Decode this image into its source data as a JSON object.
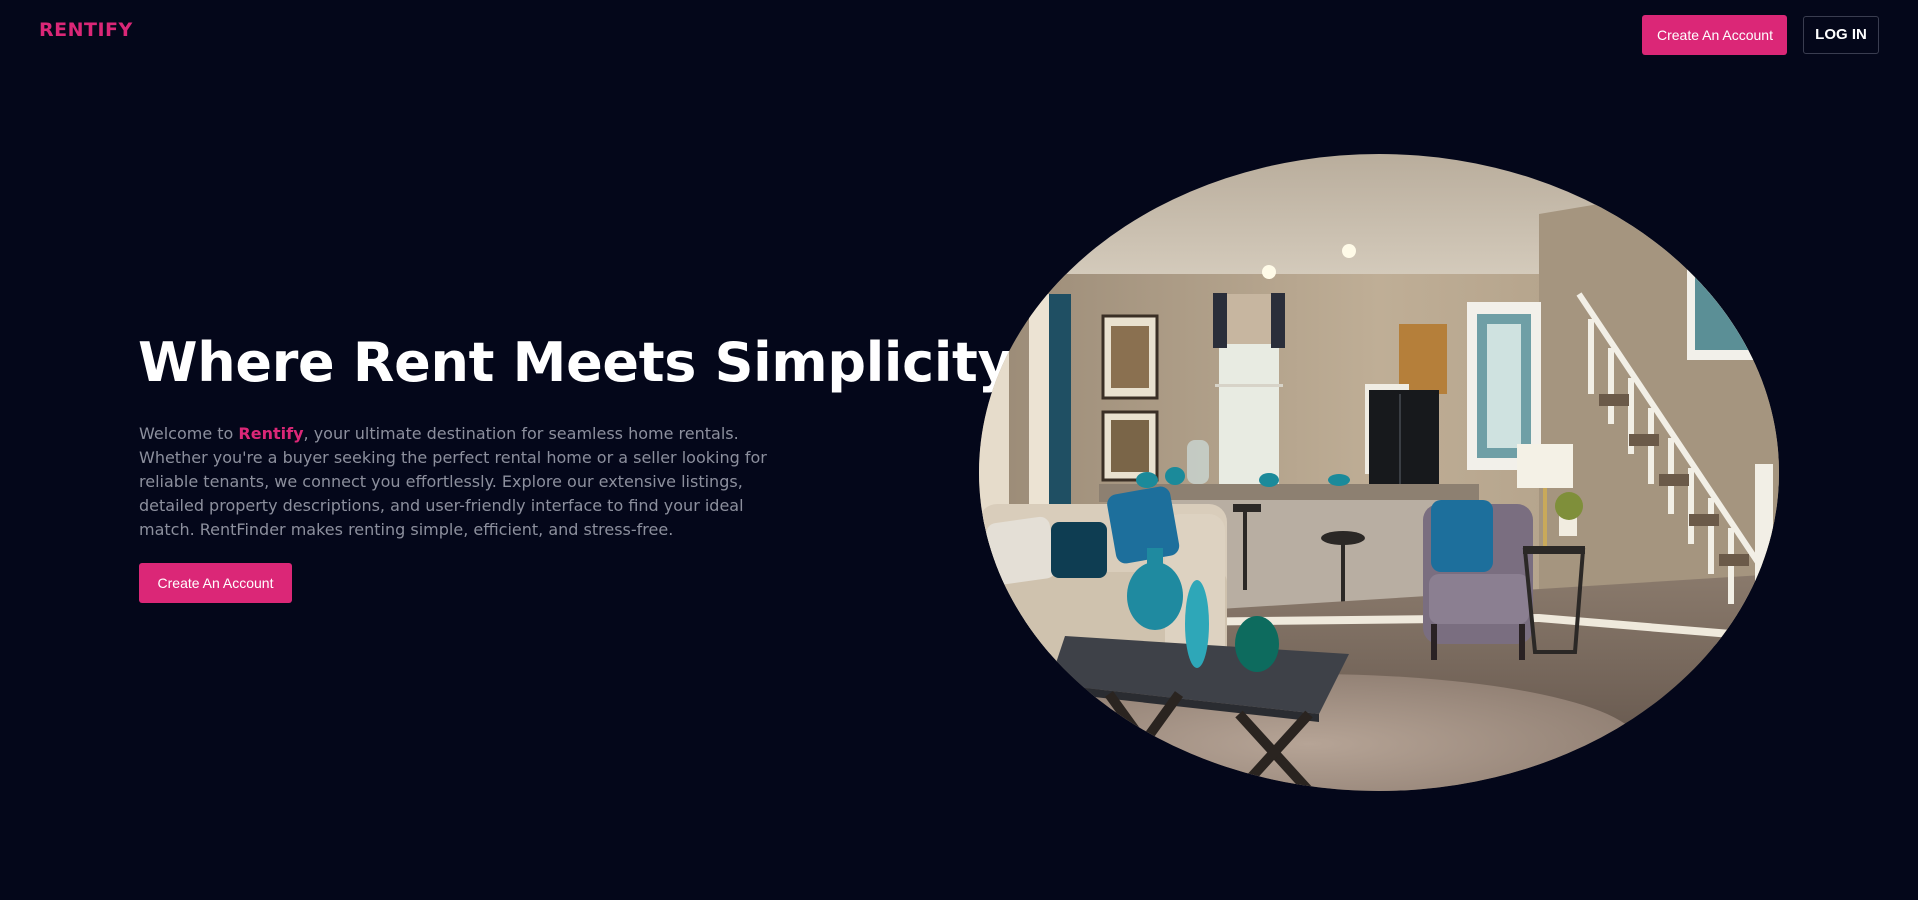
{
  "header": {
    "logo": "RENTIFY",
    "create_account_label": "Create An Account",
    "login_label": "LOG IN"
  },
  "hero": {
    "title": "Where Rent Meets Simplicity",
    "description_prefix": "Welcome to ",
    "description_brand": "Rentify",
    "description_suffix": ", your ultimate destination for seamless home rentals. Whether you're a buyer seeking the perfect rental home or a seller looking for reliable tenants, we connect you effortlessly. Explore our extensive listings, detailed property descriptions, and user-friendly interface to find your ideal match. RentFinder makes renting simple, efficient, and stress-free.",
    "cta_label": "Create An Account"
  },
  "colors": {
    "background": "#04071a",
    "accent": "#db2777",
    "text_primary": "#ffffff",
    "text_muted": "#8c8f9d"
  }
}
